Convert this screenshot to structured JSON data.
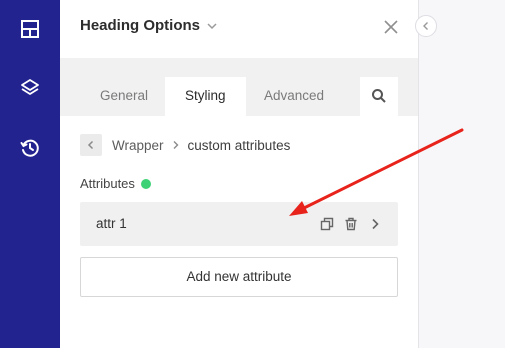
{
  "left_sidebar": {
    "icons": [
      "layout-grid-icon",
      "layers-icon",
      "history-icon"
    ],
    "background": "#22238f"
  },
  "panel": {
    "title": "Heading Options",
    "tabs": [
      {
        "label": "General",
        "active": false
      },
      {
        "label": "Styling",
        "active": true
      },
      {
        "label": "Advanced",
        "active": false
      }
    ],
    "breadcrumb": {
      "parent": "Wrapper",
      "current": "custom attributes"
    },
    "attributes": {
      "heading": "Attributes",
      "status_color": "#3ed276",
      "items": [
        {
          "name": "attr 1"
        }
      ],
      "add_button": "Add new attribute"
    }
  },
  "annotation": {
    "arrow_color": "#e8231b"
  }
}
